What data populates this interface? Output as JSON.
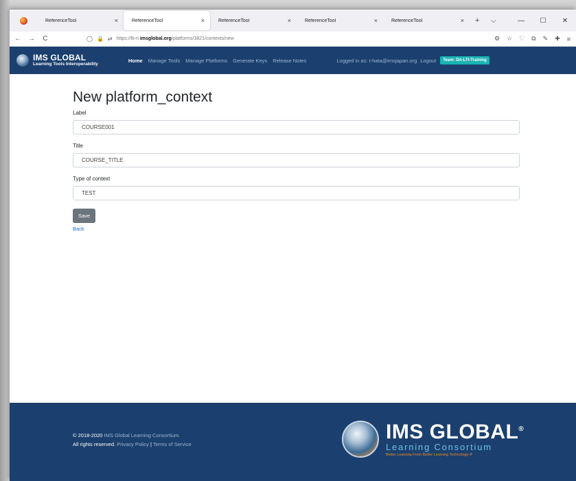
{
  "browser": {
    "tabs": [
      {
        "label": "ReferenceTool",
        "close": "×"
      },
      {
        "label": "ReferenceTool",
        "close": "×"
      },
      {
        "label": "ReferenceTool",
        "close": "×"
      },
      {
        "label": "ReferenceTool",
        "close": "×"
      },
      {
        "label": "ReferenceTool",
        "close": "×"
      }
    ],
    "new_tab": "+",
    "tab_list": "⌵",
    "window_controls": {
      "minimize": "—",
      "maximize": "☐",
      "close": "✕"
    },
    "nav": {
      "back": "←",
      "forward": "→",
      "reload": "C"
    },
    "url_prefix": "https://lti-ri.",
    "url_domain": "imsglobal.org",
    "url_path": "/platforms/3821/contexts/new"
  },
  "header": {
    "brand_title": "IMS GLOBAL",
    "brand_subtitle": "Learning Tools Interoperability",
    "menu": [
      "Home",
      "Manage Tools",
      "Manage Platforms",
      "Generate Keys",
      "Release Notes"
    ],
    "login_text": "Logged in as: t-hata@imsjapan.org",
    "logout_label": "Logout",
    "team_badge": "Team: DA-LTI-Training"
  },
  "form": {
    "page_title": "New platform_context",
    "label_label": "Label",
    "label_value": "COURSE001",
    "title_label": "Title",
    "title_value": "COURSE_TITLE",
    "type_label": "Type of context",
    "type_value": "TEST",
    "save_label": "Save",
    "back_label": "Back"
  },
  "footer": {
    "copyright_prefix": "© 2018-2020 ",
    "copyright_org": "IMS Global Learning Consortium.",
    "rights_prefix": "All rights reserved. ",
    "privacy_label": "Privacy Policy",
    "separator": "|",
    "terms_label": "Terms of Service",
    "logo_title": "IMS GLOBAL",
    "logo_reg": "®",
    "logo_subtitle": "Learning Consortium",
    "logo_tagline": "Better Learning From Better Learning Technology ®"
  }
}
